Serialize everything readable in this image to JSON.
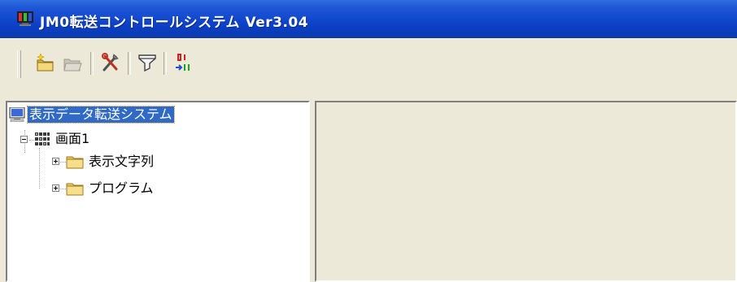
{
  "window": {
    "title": "JM0転送コントロールシステム Ver3.04",
    "icon": "monitor-app-icon"
  },
  "toolbar": {
    "buttons": [
      {
        "name": "new-button",
        "icon": "new-folder-sparkle-icon",
        "enabled": true
      },
      {
        "name": "open-button",
        "icon": "folder-open-icon",
        "enabled": false
      },
      {
        "name": "settings-button",
        "icon": "tools-icon",
        "enabled": true
      },
      {
        "name": "filter-button",
        "icon": "filter-funnel-icon",
        "enabled": true
      },
      {
        "name": "transfer-button",
        "icon": "binary-transfer-icon",
        "enabled": true
      }
    ]
  },
  "tree": {
    "root": {
      "label": "表示データ転送システム",
      "icon": "computer-icon",
      "selected": true
    },
    "screen": {
      "label": "画面1",
      "icon": "grid-icon",
      "expanded": true
    },
    "children": [
      {
        "label": "表示文字列",
        "icon": "folder-icon",
        "expanded": false
      },
      {
        "label": "プログラム",
        "icon": "folder-icon",
        "expanded": false
      }
    ]
  },
  "colors": {
    "titlebar": "#0a3fc6",
    "face": "#ece9d8",
    "selection": "#316ac5"
  }
}
